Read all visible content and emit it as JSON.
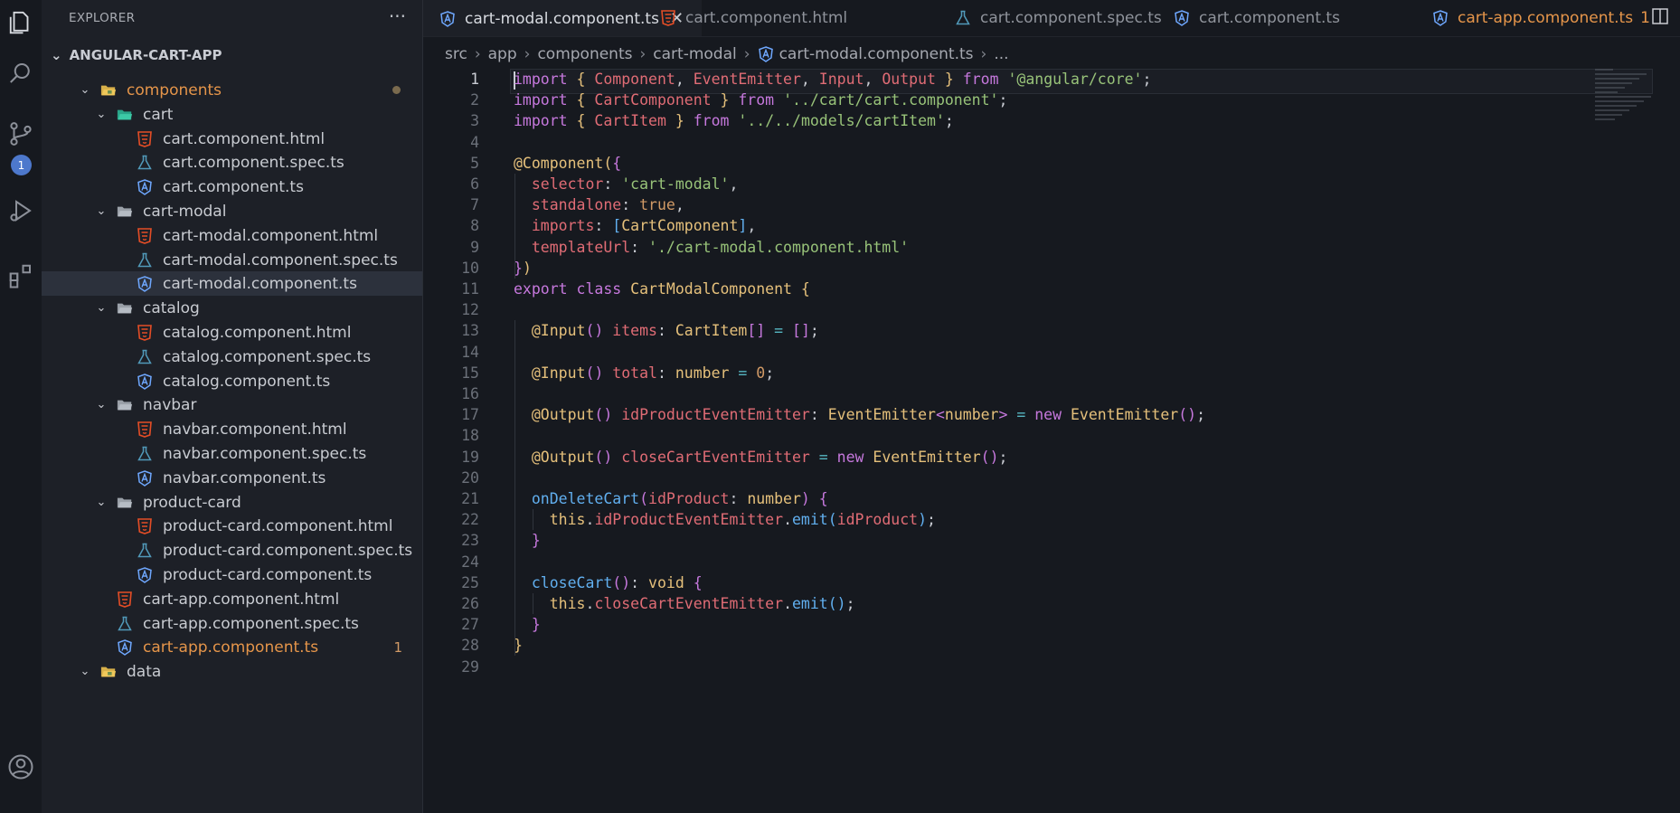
{
  "activity_bar": {
    "icons": [
      "files-icon",
      "search-icon",
      "source-control-icon",
      "run-debug-icon",
      "extensions-icon",
      "account-icon"
    ],
    "scm_badge": "1"
  },
  "sidebar": {
    "title": "EXPLORER",
    "more": "···",
    "root": "ANGULAR-CART-APP",
    "items": [
      {
        "label": "components",
        "type": "folder-open-special",
        "depth": 1,
        "chevron": "v",
        "dot": true,
        "orange": true
      },
      {
        "label": "cart",
        "type": "folder-open-special2",
        "depth": 2,
        "chevron": "v"
      },
      {
        "label": "cart.component.html",
        "type": "html",
        "depth": 3
      },
      {
        "label": "cart.component.spec.ts",
        "type": "spec",
        "depth": 3
      },
      {
        "label": "cart.component.ts",
        "type": "angular",
        "depth": 3
      },
      {
        "label": "cart-modal",
        "type": "folder-open",
        "depth": 2,
        "chevron": "v"
      },
      {
        "label": "cart-modal.component.html",
        "type": "html",
        "depth": 3
      },
      {
        "label": "cart-modal.component.spec.ts",
        "type": "spec",
        "depth": 3
      },
      {
        "label": "cart-modal.component.ts",
        "type": "angular",
        "depth": 3,
        "selected": true
      },
      {
        "label": "catalog",
        "type": "folder-open",
        "depth": 2,
        "chevron": "v"
      },
      {
        "label": "catalog.component.html",
        "type": "html",
        "depth": 3
      },
      {
        "label": "catalog.component.spec.ts",
        "type": "spec",
        "depth": 3
      },
      {
        "label": "catalog.component.ts",
        "type": "angular",
        "depth": 3
      },
      {
        "label": "navbar",
        "type": "folder-open",
        "depth": 2,
        "chevron": "v"
      },
      {
        "label": "navbar.component.html",
        "type": "html",
        "depth": 3
      },
      {
        "label": "navbar.component.spec.ts",
        "type": "spec",
        "depth": 3
      },
      {
        "label": "navbar.component.ts",
        "type": "angular",
        "depth": 3
      },
      {
        "label": "product-card",
        "type": "folder-open",
        "depth": 2,
        "chevron": "v"
      },
      {
        "label": "product-card.component.html",
        "type": "html",
        "depth": 3
      },
      {
        "label": "product-card.component.spec.ts",
        "type": "spec",
        "depth": 3
      },
      {
        "label": "product-card.component.ts",
        "type": "angular",
        "depth": 3
      },
      {
        "label": "cart-app.component.html",
        "type": "html",
        "depth": 2
      },
      {
        "label": "cart-app.component.spec.ts",
        "type": "spec",
        "depth": 2
      },
      {
        "label": "cart-app.component.ts",
        "type": "angular",
        "depth": 2,
        "orange": true,
        "mod": "1"
      },
      {
        "label": "data",
        "type": "folder-open-special",
        "depth": 1,
        "chevron": "v"
      }
    ]
  },
  "tabs": [
    {
      "label": "cart-modal.component.ts",
      "type": "angular",
      "active": true,
      "close": "✕"
    },
    {
      "label": "cart.component.html",
      "type": "html"
    },
    {
      "label": "cart.component.spec.ts",
      "type": "spec"
    },
    {
      "label": "cart.component.ts",
      "type": "angular"
    },
    {
      "label": "cart-app.component.ts",
      "type": "angular",
      "orange": true,
      "mod": "1"
    }
  ],
  "breadcrumb": [
    "src",
    "app",
    "components",
    "cart-modal",
    "cart-modal.component.ts",
    "..."
  ],
  "editor": {
    "current_line": 1,
    "lines": [
      [
        [
          "k",
          "import"
        ],
        [
          "p",
          " "
        ],
        [
          "b1",
          "{"
        ],
        [
          "p",
          " "
        ],
        [
          "i",
          "Component"
        ],
        [
          "p",
          ", "
        ],
        [
          "i",
          "EventEmitter"
        ],
        [
          "p",
          ", "
        ],
        [
          "i",
          "Input"
        ],
        [
          "p",
          ", "
        ],
        [
          "i",
          "Output"
        ],
        [
          "p",
          " "
        ],
        [
          "b1",
          "}"
        ],
        [
          "p",
          " "
        ],
        [
          "k",
          "from"
        ],
        [
          "p",
          " "
        ],
        [
          "s",
          "'@angular/core'"
        ],
        [
          "p",
          ";"
        ]
      ],
      [
        [
          "k",
          "import"
        ],
        [
          "p",
          " "
        ],
        [
          "b1",
          "{"
        ],
        [
          "p",
          " "
        ],
        [
          "i",
          "CartComponent"
        ],
        [
          "p",
          " "
        ],
        [
          "b1",
          "}"
        ],
        [
          "p",
          " "
        ],
        [
          "k",
          "from"
        ],
        [
          "p",
          " "
        ],
        [
          "s",
          "'../cart/cart.component'"
        ],
        [
          "p",
          ";"
        ]
      ],
      [
        [
          "k",
          "import"
        ],
        [
          "p",
          " "
        ],
        [
          "b1",
          "{"
        ],
        [
          "p",
          " "
        ],
        [
          "i",
          "CartItem"
        ],
        [
          "p",
          " "
        ],
        [
          "b1",
          "}"
        ],
        [
          "p",
          " "
        ],
        [
          "k",
          "from"
        ],
        [
          "p",
          " "
        ],
        [
          "s",
          "'../../models/cartItem'"
        ],
        [
          "p",
          ";"
        ]
      ],
      [],
      [
        [
          "d",
          "@Component"
        ],
        [
          "b1",
          "("
        ],
        [
          "b2",
          "{"
        ]
      ],
      [
        [
          "p",
          "  "
        ],
        [
          "i",
          "selector"
        ],
        [
          "p",
          ": "
        ],
        [
          "s",
          "'cart-modal'"
        ],
        [
          "p",
          ","
        ]
      ],
      [
        [
          "p",
          "  "
        ],
        [
          "i",
          "standalone"
        ],
        [
          "p",
          ": "
        ],
        [
          "n",
          "true"
        ],
        [
          "p",
          ","
        ]
      ],
      [
        [
          "p",
          "  "
        ],
        [
          "i",
          "imports"
        ],
        [
          "p",
          ": "
        ],
        [
          "b3",
          "["
        ],
        [
          "t",
          "CartComponent"
        ],
        [
          "b3",
          "]"
        ],
        [
          "p",
          ","
        ]
      ],
      [
        [
          "p",
          "  "
        ],
        [
          "i",
          "templateUrl"
        ],
        [
          "p",
          ": "
        ],
        [
          "s",
          "'./cart-modal.component.html'"
        ]
      ],
      [
        [
          "b2",
          "}"
        ],
        [
          "b1",
          ")"
        ]
      ],
      [
        [
          "k",
          "export"
        ],
        [
          "p",
          " "
        ],
        [
          "k",
          "class"
        ],
        [
          "p",
          " "
        ],
        [
          "t",
          "CartModalComponent"
        ],
        [
          "p",
          " "
        ],
        [
          "b1",
          "{"
        ]
      ],
      [],
      [
        [
          "p",
          "  "
        ],
        [
          "d",
          "@Input"
        ],
        [
          "b2",
          "()"
        ],
        [
          "p",
          " "
        ],
        [
          "i",
          "items"
        ],
        [
          "p",
          ": "
        ],
        [
          "t",
          "CartItem"
        ],
        [
          "b2",
          "[]"
        ],
        [
          "p",
          " "
        ],
        [
          "op",
          "="
        ],
        [
          "p",
          " "
        ],
        [
          "b2",
          "[]"
        ],
        [
          "p",
          ";"
        ]
      ],
      [],
      [
        [
          "p",
          "  "
        ],
        [
          "d",
          "@Input"
        ],
        [
          "b2",
          "()"
        ],
        [
          "p",
          " "
        ],
        [
          "i",
          "total"
        ],
        [
          "p",
          ": "
        ],
        [
          "t",
          "number"
        ],
        [
          "p",
          " "
        ],
        [
          "op",
          "="
        ],
        [
          "p",
          " "
        ],
        [
          "n",
          "0"
        ],
        [
          "p",
          ";"
        ]
      ],
      [],
      [
        [
          "p",
          "  "
        ],
        [
          "d",
          "@Output"
        ],
        [
          "b2",
          "()"
        ],
        [
          "p",
          " "
        ],
        [
          "i",
          "idProductEventEmitter"
        ],
        [
          "p",
          ": "
        ],
        [
          "t",
          "EventEmitter"
        ],
        [
          "b2",
          "<"
        ],
        [
          "t",
          "number"
        ],
        [
          "b2",
          ">"
        ],
        [
          "p",
          " "
        ],
        [
          "op",
          "="
        ],
        [
          "p",
          " "
        ],
        [
          "k",
          "new"
        ],
        [
          "p",
          " "
        ],
        [
          "t",
          "EventEmitter"
        ],
        [
          "b2",
          "()"
        ],
        [
          "p",
          ";"
        ]
      ],
      [],
      [
        [
          "p",
          "  "
        ],
        [
          "d",
          "@Output"
        ],
        [
          "b2",
          "()"
        ],
        [
          "p",
          " "
        ],
        [
          "i",
          "closeCartEventEmitter"
        ],
        [
          "p",
          " "
        ],
        [
          "op",
          "="
        ],
        [
          "p",
          " "
        ],
        [
          "k",
          "new"
        ],
        [
          "p",
          " "
        ],
        [
          "t",
          "EventEmitter"
        ],
        [
          "b2",
          "()"
        ],
        [
          "p",
          ";"
        ]
      ],
      [],
      [
        [
          "p",
          "  "
        ],
        [
          "f",
          "onDeleteCart"
        ],
        [
          "b2",
          "("
        ],
        [
          "i",
          "idProduct"
        ],
        [
          "p",
          ": "
        ],
        [
          "t",
          "number"
        ],
        [
          "b2",
          ")"
        ],
        [
          "p",
          " "
        ],
        [
          "b2",
          "{"
        ]
      ],
      [
        [
          "p",
          "    "
        ],
        [
          "t",
          "this"
        ],
        [
          "p",
          "."
        ],
        [
          "i",
          "idProductEventEmitter"
        ],
        [
          "p",
          "."
        ],
        [
          "f",
          "emit"
        ],
        [
          "b3",
          "("
        ],
        [
          "i",
          "idProduct"
        ],
        [
          "b3",
          ")"
        ],
        [
          "p",
          ";"
        ]
      ],
      [
        [
          "p",
          "  "
        ],
        [
          "b2",
          "}"
        ]
      ],
      [],
      [
        [
          "p",
          "  "
        ],
        [
          "f",
          "closeCart"
        ],
        [
          "b2",
          "()"
        ],
        [
          "p",
          ": "
        ],
        [
          "t",
          "void"
        ],
        [
          "p",
          " "
        ],
        [
          "b2",
          "{"
        ]
      ],
      [
        [
          "p",
          "    "
        ],
        [
          "t",
          "this"
        ],
        [
          "p",
          "."
        ],
        [
          "i",
          "closeCartEventEmitter"
        ],
        [
          "p",
          "."
        ],
        [
          "f",
          "emit"
        ],
        [
          "b3",
          "()"
        ],
        [
          "p",
          ";"
        ]
      ],
      [
        [
          "p",
          "  "
        ],
        [
          "b2",
          "}"
        ]
      ],
      [
        [
          "b1",
          "}"
        ]
      ],
      []
    ]
  },
  "colors": {
    "accent": "#4d78cc",
    "modified": "#e5954a",
    "html": "#e44d26",
    "spec": "#519aba",
    "angular": "#6fa8ff"
  }
}
